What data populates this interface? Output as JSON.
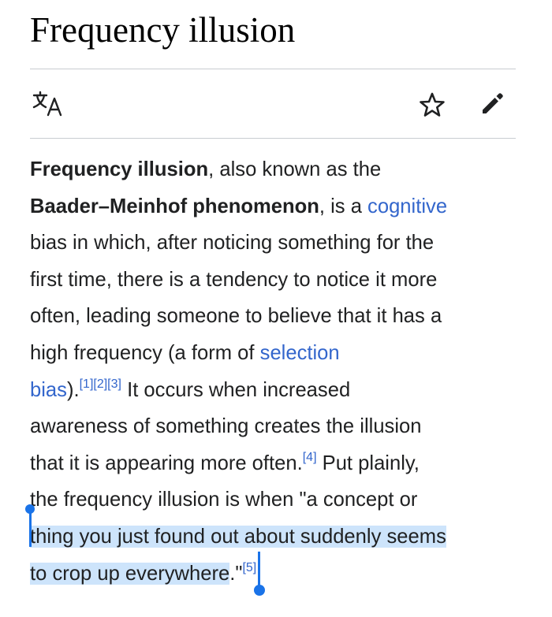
{
  "page": {
    "title": "Frequency illusion"
  },
  "toolbar": {
    "language_icon": "translate-icon",
    "watch_icon": "star-icon",
    "edit_icon": "pencil-icon"
  },
  "article": {
    "lines": [
      [
        {
          "t": "Frequency illusion",
          "s": "bold"
        },
        {
          "t": ", also known as the",
          "s": "text"
        }
      ],
      [
        {
          "t": "Baader–Meinhof phenomenon",
          "s": "bold"
        },
        {
          "t": ", is a ",
          "s": "text"
        },
        {
          "t": "cognitive",
          "s": "link"
        }
      ],
      [
        {
          "t": "bias in which, after noticing something for the",
          "s": "text"
        }
      ],
      [
        {
          "t": "first time, there is a tendency to notice it more",
          "s": "text"
        }
      ],
      [
        {
          "t": "often, leading someone to believe that it has a",
          "s": "text"
        }
      ],
      [
        {
          "t": "high frequency (a form of ",
          "s": "text"
        },
        {
          "t": "selection",
          "s": "link"
        }
      ],
      [
        {
          "t": "bias",
          "s": "link"
        },
        {
          "t": ").",
          "s": "text"
        },
        {
          "t": "[1][2][3]",
          "s": "ref"
        },
        {
          "t": " It occurs when increased",
          "s": "text"
        }
      ],
      [
        {
          "t": "awareness of something creates the illusion",
          "s": "text"
        }
      ],
      [
        {
          "t": "that it is appearing more often.",
          "s": "text"
        },
        {
          "t": "[4]",
          "s": "ref"
        },
        {
          "t": " Put plainly,",
          "s": "text"
        }
      ],
      [
        {
          "t": "the frequency illusion is when \"a concept or",
          "s": "text"
        }
      ],
      [
        {
          "t": "thing you just found out about suddenly seems",
          "s": "highlight"
        }
      ],
      [
        {
          "t": "to crop up everywhere",
          "s": "highlight"
        },
        {
          "t": ".\"",
          "s": "text"
        },
        {
          "t": "[5]",
          "s": "ref"
        }
      ]
    ]
  },
  "colors": {
    "link": "#3366cc",
    "selection": "#cde4fb",
    "selection_handle": "#1a73e8",
    "divider": "#c8ccd1"
  }
}
